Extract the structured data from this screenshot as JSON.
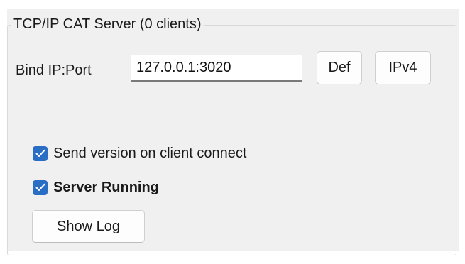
{
  "group": {
    "title": "TCP/IP CAT Server (0 clients)"
  },
  "bind": {
    "label": "Bind IP:Port",
    "value": "127.0.0.1:3020",
    "def_label": "Def",
    "ipv4_label": "IPv4"
  },
  "options": {
    "send_version": {
      "label": "Send version on client connect",
      "checked": true
    },
    "server_running": {
      "label": "Server Running",
      "checked": true
    }
  },
  "show_log_label": "Show Log",
  "colors": {
    "accent": "#2a6dc5",
    "panel_bg": "#f0f0f0"
  },
  "icons": {
    "checkbox": "checkmark-icon"
  }
}
